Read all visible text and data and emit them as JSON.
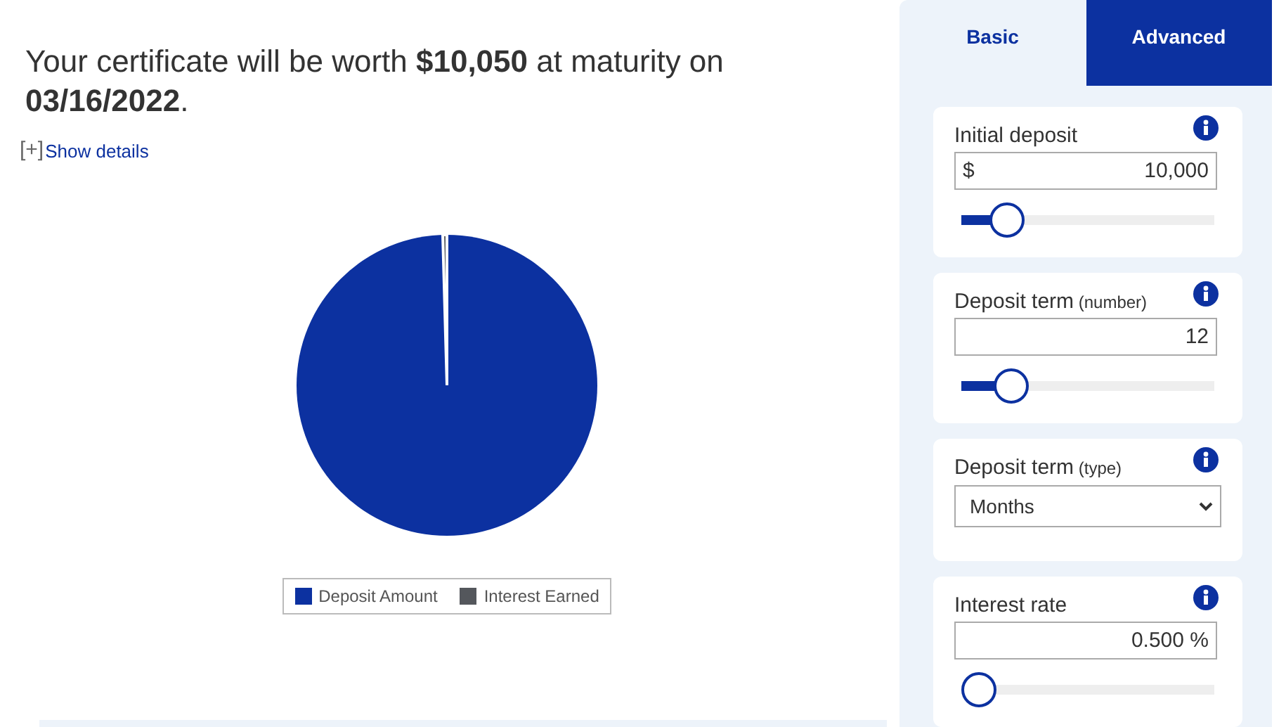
{
  "summary": "Your certificate will be worth **$10,050** at maturity on **03/16/2022**.",
  "details_toggle": {
    "icon": "[+]",
    "label": "Show details",
    "expanded": false
  },
  "legend": [
    {
      "label": "Deposit Amount",
      "color": "#0c31a0"
    },
    {
      "label": "Interest Earned",
      "color": "#54575c"
    }
  ],
  "tabs": [
    {
      "label": "Basic",
      "selected": false
    },
    {
      "label": "Advanced",
      "selected": true
    }
  ],
  "fields": [
    {
      "kind": "input",
      "label": "Initial deposit",
      "prefix": "$",
      "value": "10,000",
      "slider": {
        "level": 0.13
      }
    },
    {
      "kind": "input",
      "label": "Deposit term",
      "note": "(number)",
      "value": "12",
      "slider": {
        "level": 0.15
      }
    },
    {
      "kind": "select",
      "label": "Deposit term",
      "note": "(type)",
      "value": "Months"
    },
    {
      "kind": "input",
      "label": "Interest rate",
      "value": "0.500 %",
      "slider": {
        "level": 0
      }
    }
  ]
}
